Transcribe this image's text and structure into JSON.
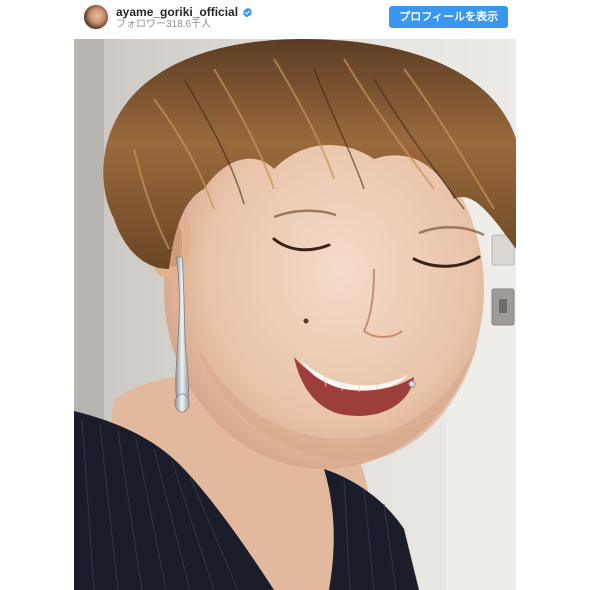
{
  "post": {
    "username": "ayame_goriki_official",
    "followers_label": "フォロワー318.6千人",
    "view_profile_label": "プロフィールを表示",
    "verified": true,
    "icons": {
      "verified": "verified-badge-icon",
      "avatar": "profile-avatar"
    },
    "colors": {
      "button": "#3897f0",
      "username": "#262626",
      "followers": "#8e8e8e",
      "verified": "#3897f0"
    }
  }
}
